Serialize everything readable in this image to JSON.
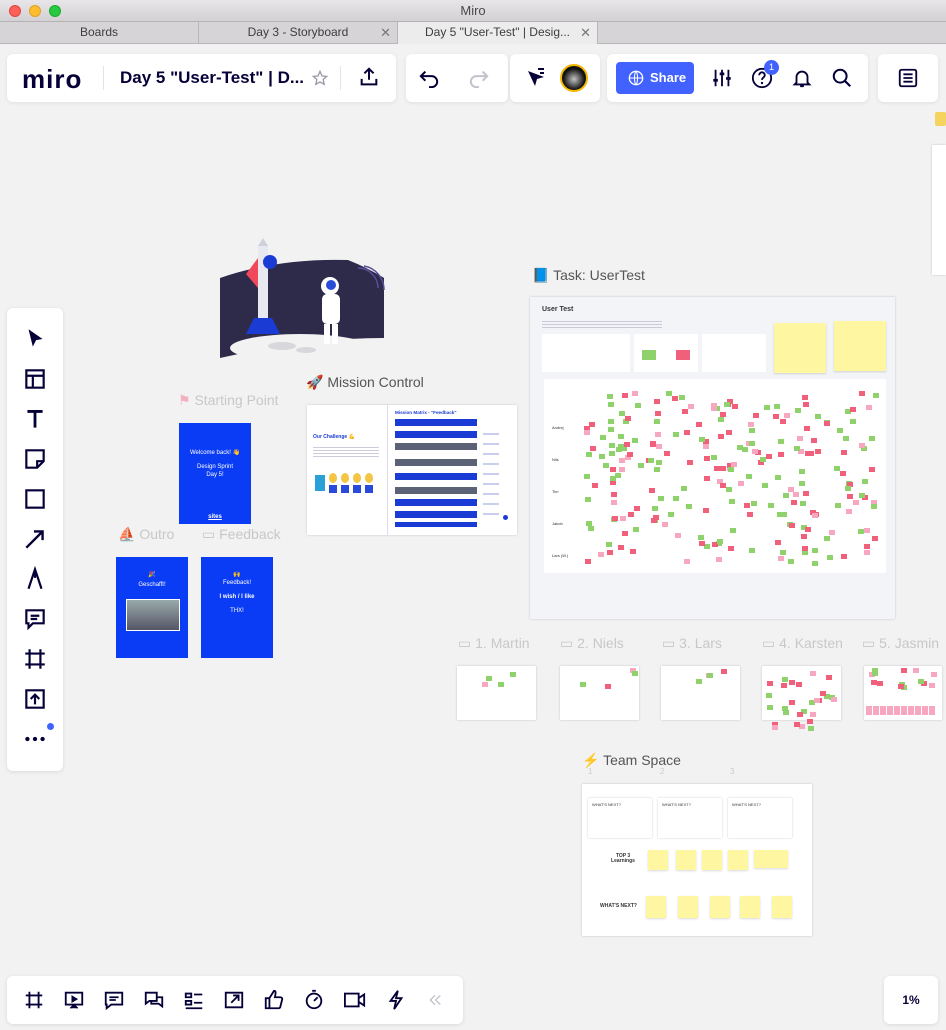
{
  "window": {
    "title": "Miro"
  },
  "tabs": [
    {
      "label": "Boards",
      "active": false,
      "closable": false
    },
    {
      "label": "Day 3 - Storyboard",
      "active": false,
      "closable": true
    },
    {
      "label": "Day 5 \"User-Test\" | Desig...",
      "active": true,
      "closable": true
    }
  ],
  "toolbar": {
    "logo": "miro",
    "board_title": "Day 5 \"User-Test\" | D...",
    "share_label": "Share",
    "notifications_count": "1",
    "accent_color": "#4262ff"
  },
  "left_tools": [
    "select-icon",
    "templates-icon",
    "text-icon",
    "sticky-note-icon",
    "shape-icon",
    "connection-line-icon",
    "pen-icon",
    "comment-icon",
    "frame-icon",
    "upload-icon",
    "more-icon"
  ],
  "bottom_tools": [
    "frames-icon",
    "presentation-icon",
    "comments-icon",
    "chat-icon",
    "cards-icon",
    "screen-share-icon",
    "voting-icon",
    "timer-icon",
    "video-chat-icon",
    "activity-icon",
    "collapse-icon"
  ],
  "zoom_level": "1%",
  "canvas": {
    "starting_point": {
      "label": "Starting Point",
      "card_line1": "Welcome back! 👋",
      "card_line2": "Design Sprint",
      "card_line3": "Day 5!",
      "card_footer": "sites"
    },
    "mission_control": {
      "label": "🚀 Mission Control",
      "heading": "Mission Matrix - \"Feedback\"",
      "challenge": "Our Challenge 💪"
    },
    "task": {
      "label": "📘 Task: UserTest",
      "title": "User Test",
      "rows": [
        "Andrej",
        "Nils",
        "Tim",
        "Jakob",
        "Lars (W.)"
      ]
    },
    "outro": {
      "label": "Outro",
      "title": "Geschafft!"
    },
    "feedback": {
      "label": "Feedback",
      "title": "Feedback!",
      "line": "I wish / I like",
      "footer": "THX!"
    },
    "persons": [
      "1. Martin",
      "2. Niels",
      "3. Lars",
      "4. Karsten",
      "5. Jasmin"
    ],
    "team_space": {
      "label": "⚡ Team Space",
      "numbers": [
        "1",
        "2",
        "3"
      ],
      "cards": [
        "WHAT'S NEXT?",
        "WHAT'S NEXT?",
        "WHAT'S NEXT?"
      ],
      "top3": "TOP 3 Learnings",
      "whats_next": "WHAT'S NEXT?"
    }
  }
}
